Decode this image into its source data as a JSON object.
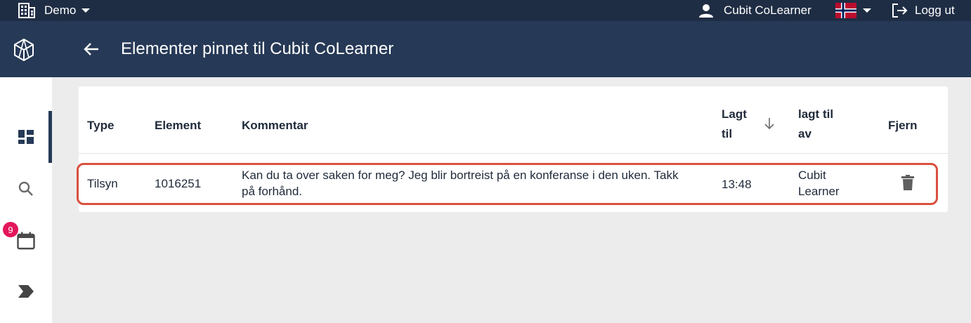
{
  "topbar": {
    "org_label": "Demo",
    "user_name": "Cubit CoLearner",
    "logout_label": "Logg ut",
    "flag_colors": {
      "red": "#ba0c2f",
      "white": "#ffffff",
      "blue": "#00205b"
    }
  },
  "header": {
    "title": "Elementer pinnet til Cubit CoLearner"
  },
  "sidebar": {
    "calendar_badge": "9"
  },
  "table": {
    "headers": {
      "type": "Type",
      "element": "Element",
      "comment": "Kommentar",
      "added_line1": "Lagt",
      "added_line2": "til",
      "added_by_line1": "lagt til",
      "added_by_line2": "av",
      "remove": "Fjern"
    },
    "rows": [
      {
        "type": "Tilsyn",
        "element": "1016251",
        "comment_line1": "Kan du ta over saken for meg? Jeg blir bortreist på en konferanse i den uken. Takk",
        "comment_line2": "på forhånd.",
        "added": "13:48",
        "added_by_line1": "Cubit",
        "added_by_line2": "Learner"
      }
    ]
  },
  "colors": {
    "topbar": "#1f2d44",
    "header": "#263956",
    "highlight": "#d9503f",
    "badge": "#e3165b"
  }
}
